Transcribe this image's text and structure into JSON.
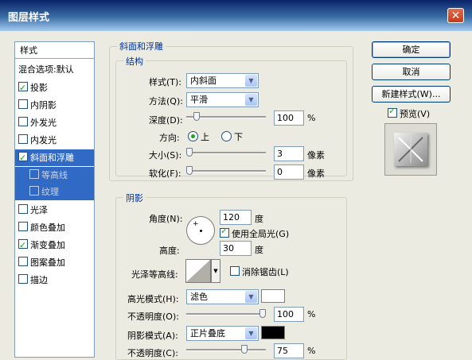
{
  "window": {
    "title": "图层样式",
    "close_glyph": "✕"
  },
  "style_list": {
    "header": "样式",
    "blend_options": "混合选项:默认",
    "items": [
      {
        "label": "投影",
        "checked": true
      },
      {
        "label": "内阴影",
        "checked": false
      },
      {
        "label": "外发光",
        "checked": false
      },
      {
        "label": "内发光",
        "checked": false
      },
      {
        "label": "斜面和浮雕",
        "checked": true
      },
      {
        "label": "等高线",
        "checked": false
      },
      {
        "label": "纹理",
        "checked": false
      },
      {
        "label": "光泽",
        "checked": false
      },
      {
        "label": "颜色叠加",
        "checked": false
      },
      {
        "label": "渐变叠加",
        "checked": true
      },
      {
        "label": "图案叠加",
        "checked": false
      },
      {
        "label": "描边",
        "checked": false
      }
    ]
  },
  "bevel": {
    "group_title": "斜面和浮雕",
    "structure_title": "结构",
    "style_label": "样式(T):",
    "style_value": "内斜面",
    "technique_label": "方法(Q):",
    "technique_value": "平滑",
    "depth_label": "深度(D):",
    "depth_value": "100",
    "depth_unit": "%",
    "depth_fraction": 0.1,
    "direction_label": "方向:",
    "direction_up": "上",
    "direction_down": "下",
    "direction_selected": "上",
    "size_label": "大小(S):",
    "size_value": "3",
    "size_unit": "像素",
    "soften_label": "软化(F):",
    "soften_value": "0",
    "soften_unit": "像素"
  },
  "shading": {
    "title": "阴影",
    "angle_label": "角度(N):",
    "angle_value": "120",
    "angle_unit": "度",
    "global_light_label": "使用全局光(G)",
    "global_light_checked": true,
    "altitude_label": "高度:",
    "altitude_value": "30",
    "altitude_unit": "度",
    "gloss_contour_label": "光泽等高线:",
    "anti_aliased_label": "消除锯齿(L)",
    "anti_aliased_checked": false,
    "highlight_mode_label": "高光模式(H):",
    "highlight_mode_value": "滤色",
    "highlight_color": "#ffffff",
    "highlight_opacity_label": "不透明度(O):",
    "highlight_opacity_value": "100",
    "highlight_opacity_unit": "%",
    "shadow_mode_label": "阴影模式(A):",
    "shadow_mode_value": "正片叠底",
    "shadow_color": "#000000",
    "shadow_opacity_label": "不透明度(C):",
    "shadow_opacity_value": "75",
    "shadow_opacity_unit": "%"
  },
  "buttons": {
    "ok": "确定",
    "cancel": "取消",
    "new_style": "新建样式(W)...",
    "preview_label": "预览(V)",
    "preview_checked": true
  },
  "colors": {
    "title_bar": "#0a246a",
    "selection": "#316ac5",
    "legend_text": "#003399"
  }
}
